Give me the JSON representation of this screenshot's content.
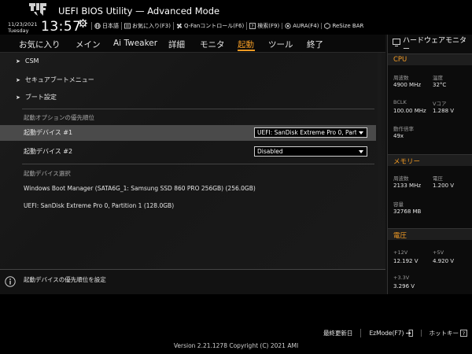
{
  "header": {
    "title": "UEFI BIOS Utility — Advanced Mode",
    "date": "11/23/2021",
    "day": "Tuesday",
    "time": "13:57",
    "toolbar": [
      {
        "label": "日本語",
        "icon": "globe-icon"
      },
      {
        "label": "お気に入り(F3)",
        "icon": "favorites-icon"
      },
      {
        "label": "Q-Fanコントロール(F6)",
        "icon": "fan-icon"
      },
      {
        "label": "検索(F9)",
        "icon": "search-help-icon"
      },
      {
        "label": "AURA(F4)",
        "icon": "aura-icon"
      },
      {
        "label": "ReSize BAR",
        "icon": "resize-bar-icon"
      }
    ]
  },
  "menu": {
    "tabs": [
      "お気に入り",
      "メイン",
      "Ai Tweaker",
      "詳細",
      "モニタ",
      "起動",
      "ツール",
      "終了"
    ],
    "active": "起動"
  },
  "main": {
    "submenus": [
      "CSM",
      "セキュアブートメニュー",
      "ブート設定"
    ],
    "priority_section": "起動オプションの優先順位",
    "boot_option_1": {
      "label": "起動デバイス #1",
      "value": "UEFI: SanDisk Extreme Pro 0, Partition 1 (128.0GB)"
    },
    "boot_option_2": {
      "label": "起動デバイス #2",
      "value": "Disabled"
    },
    "override_section": "起動デバイス選択",
    "override_items": [
      "Windows Boot Manager (SATA6G_1: Samsung SSD 860 PRO 256GB) (256.0GB)",
      "UEFI: SanDisk Extreme Pro 0, Partition 1 (128.0GB)"
    ]
  },
  "help": {
    "text": "起動デバイスの優先順位を設定"
  },
  "hw_monitor": {
    "title": "ハードウェアモニター",
    "cpu": {
      "section": "CPU",
      "freq_label": "周波数",
      "freq_value": "4900 MHz",
      "temp_label": "温度",
      "temp_value": "32°C",
      "bclk_label": "BCLK",
      "bclk_value": "100.00 MHz",
      "vcore_label": "Vコア",
      "vcore_value": "1.288 V",
      "ratio_label": "動作倍率",
      "ratio_value": "49x"
    },
    "memory": {
      "section": "メモリー",
      "freq_label": "周波数",
      "freq_value": "2133 MHz",
      "volt_label": "電圧",
      "volt_value": "1.200 V",
      "cap_label": "容量",
      "cap_value": "32768 MB"
    },
    "voltage": {
      "section": "電圧",
      "v12_label": "+12V",
      "v12_value": "12.192 V",
      "v5_label": "+5V",
      "v5_value": "4.920 V",
      "v33_label": "+3.3V",
      "v33_value": "3.296 V"
    }
  },
  "footer": {
    "last_modified": "最終更新日",
    "ezmode": "EzMode(F7)",
    "hotkeys": "ホットキー",
    "copyright": "Version 2.21.1278 Copyright (C) 2021 AMI"
  },
  "colors": {
    "accent": "#f29b24",
    "background": "#121212",
    "highlight": "#4a4a4a"
  }
}
